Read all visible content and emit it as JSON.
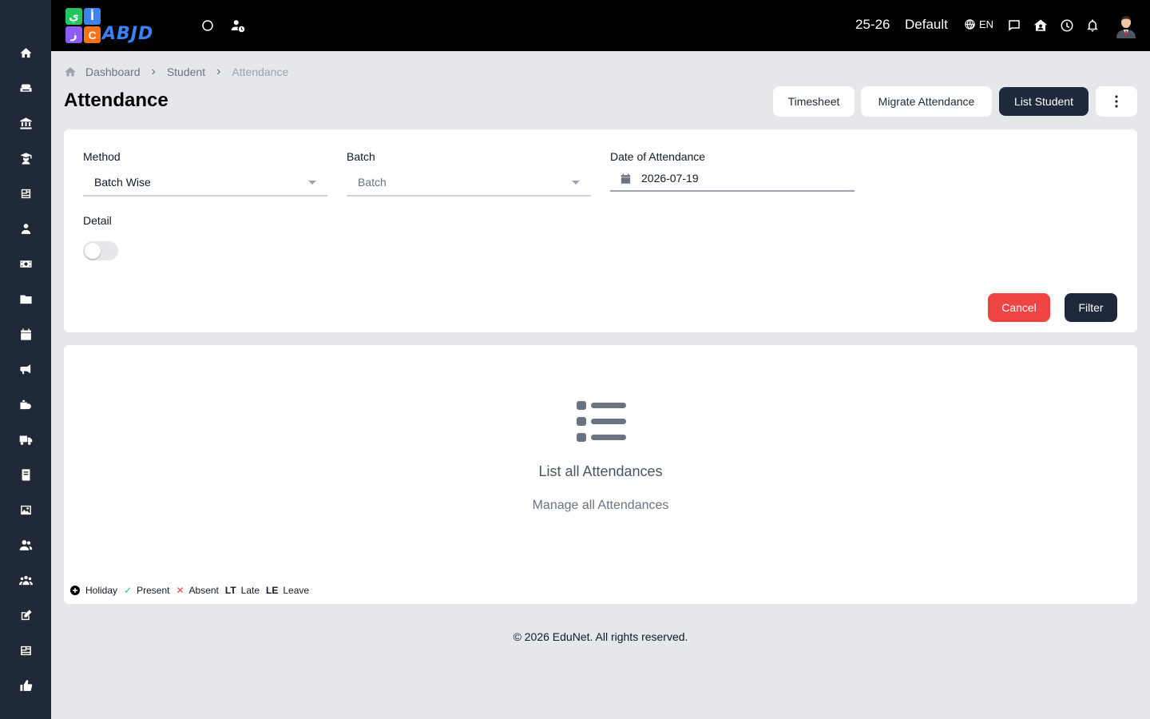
{
  "sidebar": {
    "items": [
      {
        "icon": "home-icon",
        "name": "sidebar-item-home"
      },
      {
        "icon": "sofa-icon",
        "name": "sidebar-item-front-office"
      },
      {
        "icon": "institution-icon",
        "name": "sidebar-item-academic"
      },
      {
        "icon": "graduate-icon",
        "name": "sidebar-item-student"
      },
      {
        "icon": "newspaper-icon",
        "name": "sidebar-item-exam"
      },
      {
        "icon": "user-tie-icon",
        "name": "sidebar-item-employee"
      },
      {
        "icon": "money-icon",
        "name": "sidebar-item-finance"
      },
      {
        "icon": "folder-icon",
        "name": "sidebar-item-resource"
      },
      {
        "icon": "calendar-icon",
        "name": "sidebar-item-calendar"
      },
      {
        "icon": "megaphone-icon",
        "name": "sidebar-item-communication"
      },
      {
        "icon": "inventory-icon",
        "name": "sidebar-item-inventory"
      },
      {
        "icon": "truck-icon",
        "name": "sidebar-item-transport"
      },
      {
        "icon": "book-icon",
        "name": "sidebar-item-library"
      },
      {
        "icon": "image-icon",
        "name": "sidebar-item-gallery"
      },
      {
        "icon": "users-icon",
        "name": "sidebar-item-users"
      },
      {
        "icon": "group-icon",
        "name": "sidebar-item-groups"
      },
      {
        "icon": "edit-icon",
        "name": "sidebar-item-edit"
      },
      {
        "icon": "news-icon",
        "name": "sidebar-item-news"
      },
      {
        "icon": "thumbs-up-icon",
        "name": "sidebar-item-feedback"
      }
    ]
  },
  "topbar": {
    "logo": {
      "tile_1": "ي",
      "tile_2": "أ",
      "tile_3": "ز",
      "tile_4": "C",
      "word": "ABJD"
    },
    "session": "25-26",
    "period": "Default",
    "language": "EN"
  },
  "breadcrumb": {
    "items": [
      "Dashboard",
      "Student",
      "Attendance"
    ]
  },
  "page": {
    "title": "Attendance"
  },
  "actions": {
    "timesheet": "Timesheet",
    "migrate": "Migrate Attendance",
    "list_student": "List Student"
  },
  "filter": {
    "method_label": "Method",
    "method_value": "Batch Wise",
    "batch_label": "Batch",
    "batch_placeholder": "Batch",
    "date_label": "Date of Attendance",
    "date_value": "2026-07-19",
    "detail_label": "Detail",
    "detail_enabled": false,
    "cancel": "Cancel",
    "filter": "Filter"
  },
  "empty_state": {
    "title": "List all Attendances",
    "subtitle": "Manage all Attendances"
  },
  "legend": {
    "holiday": "Holiday",
    "present": "Present",
    "absent": "Absent",
    "late_code": "LT",
    "late": "Late",
    "leave_code": "LE",
    "leave": "Leave"
  },
  "colors": {
    "sidebar": "#1f2937",
    "topbar": "#000000",
    "primary_dark": "#1e293b",
    "danger": "#ef4444",
    "present": "#22c55e",
    "absent": "#ef4444"
  },
  "footer": {
    "text": "© 2026 EduNet. All rights reserved."
  }
}
